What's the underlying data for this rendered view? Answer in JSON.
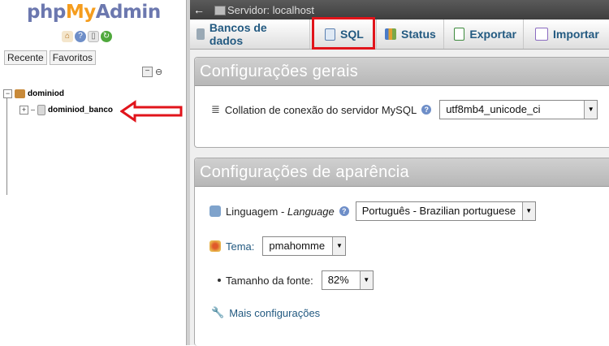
{
  "nav": {
    "logo": {
      "part1": "php",
      "part2": "My",
      "part3": "Admin"
    },
    "icons": [
      "home-icon",
      "help-icon",
      "docs-icon",
      "reload-icon"
    ],
    "tabs": [
      "Recente",
      "Favoritos"
    ],
    "tree": {
      "server_node": "dominiod",
      "database_node": "dominiod_banco"
    }
  },
  "topbar": {
    "back_glyph": "←",
    "breadcrumb": "Servidor: localhost"
  },
  "tabs": [
    {
      "label": "Bancos de dados",
      "icon": "database-icon"
    },
    {
      "label": "SQL",
      "icon": "sql-icon"
    },
    {
      "label": "Status",
      "icon": "status-icon"
    },
    {
      "label": "Exportar",
      "icon": "export-icon"
    },
    {
      "label": "Importar",
      "icon": "import-icon"
    }
  ],
  "general": {
    "title": "Configurações gerais",
    "collation_label": "Collation de conexão do servidor MySQL",
    "collation_value": "utf8mb4_unicode_ci"
  },
  "appearance": {
    "title": "Configurações de aparência",
    "language_label": "Linguagem - ",
    "language_label_en": "Language",
    "language_value": "Português - Brazilian portuguese",
    "theme_label": "Tema:",
    "theme_value": "pmahomme",
    "font_size_label": "Tamanho da fonte:",
    "font_size_value": "82%",
    "more_settings": "Mais configurações"
  },
  "colors": {
    "accent_link": "#235a81",
    "highlight_red": "#e1141b",
    "logo_blue": "#6c78af",
    "logo_orange": "#f59d1e"
  }
}
